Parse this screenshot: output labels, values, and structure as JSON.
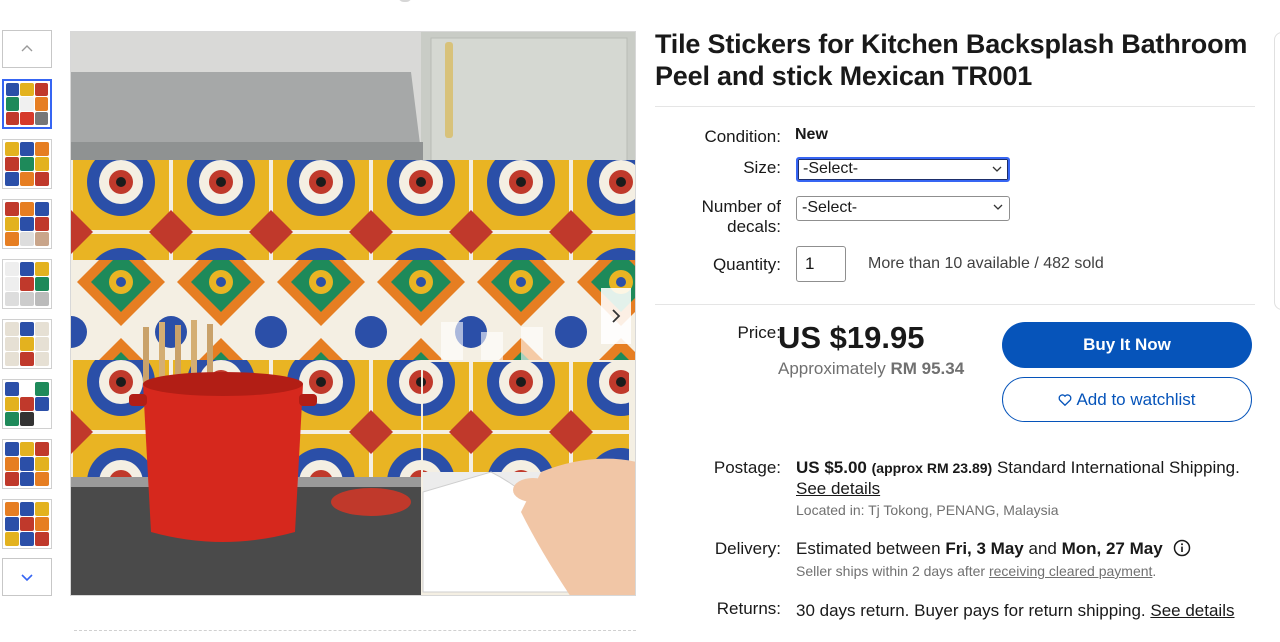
{
  "listing": {
    "title": "Tile Stickers for Kitchen Backsplash Bathroom Peel and stick Mexican TR001"
  },
  "gallery": {
    "thumbnail_count": 8,
    "selected_index": 0
  },
  "variations": {
    "condition_label": "Condition:",
    "condition_value": "New",
    "size_label": "Size:",
    "size_value": "-Select-",
    "decals_label_line1": "Number of",
    "decals_label_line2": "decals:",
    "decals_value": "-Select-",
    "quantity_label": "Quantity:",
    "quantity_value": "1",
    "availability": "More than 10 available / 482 sold"
  },
  "pricing": {
    "price_label": "Price:",
    "price": "US $19.95",
    "approx_prefix": "Approximately",
    "approx_value": "RM 95.34",
    "buy_now_label": "Buy It Now",
    "watchlist_label": "Add to watchlist"
  },
  "shipping": {
    "postage_label": "Postage:",
    "postage_price": "US $5.00",
    "postage_approx": "(approx RM 23.89)",
    "postage_method": "Standard International Shipping.",
    "see_details": "See details",
    "located_in": "Located in: Tj Tokong, PENANG, Malaysia",
    "delivery_label": "Delivery:",
    "delivery_prefix": "Estimated between",
    "delivery_from": "Fri, 3 May",
    "delivery_and": "and",
    "delivery_to": "Mon, 27 May",
    "seller_ships_prefix": "Seller ships within 2 days after",
    "seller_ships_link": "receiving cleared payment",
    "seller_ships_suffix": ".",
    "returns_label": "Returns:",
    "returns_text": "30 days return. Buyer pays for return shipping.",
    "returns_link": "See details"
  },
  "colors": {
    "accent_blue": "#3665f3",
    "button_blue": "#0654ba",
    "text_primary": "#191919",
    "text_muted": "#707070"
  },
  "icons": [
    "chevron-up-icon",
    "chevron-down-icon",
    "chevron-right-icon",
    "heart-icon",
    "info-icon"
  ]
}
